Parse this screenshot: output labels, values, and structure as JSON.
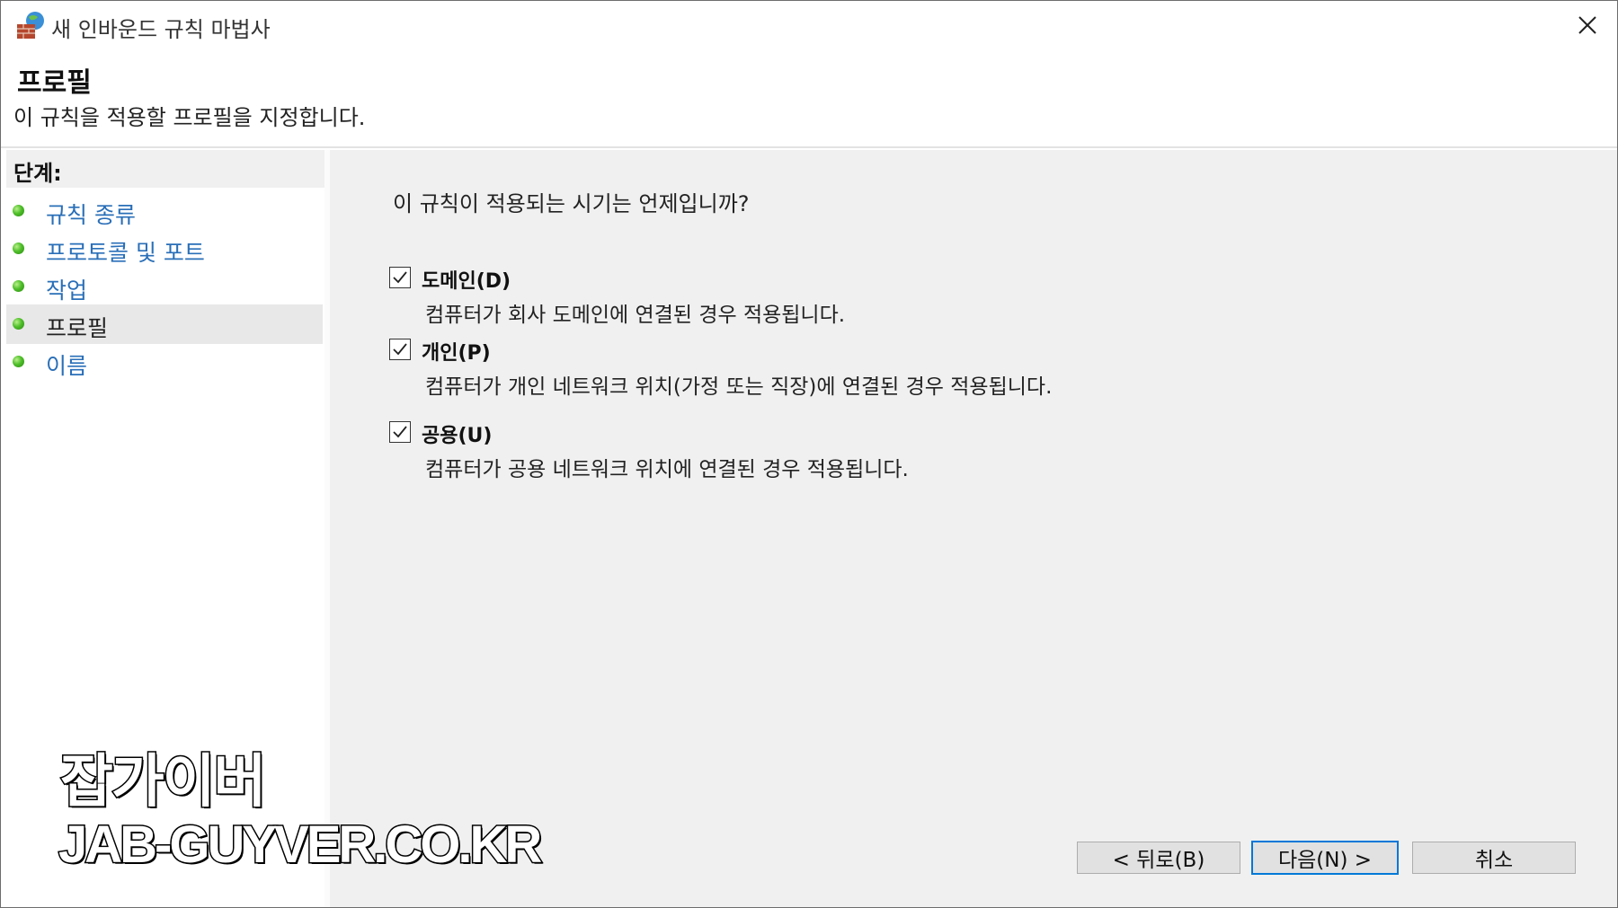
{
  "window": {
    "title": "새 인바운드 규칙 마법사",
    "close_icon": "close-icon"
  },
  "header": {
    "title": "프로필",
    "subtitle": "이 규칙을 적용할 프로필을 지정합니다."
  },
  "steps": {
    "heading": "단계:",
    "items": [
      {
        "label": "규칙 종류",
        "current": false
      },
      {
        "label": "프로토콜 및 포트",
        "current": false
      },
      {
        "label": "작업",
        "current": false
      },
      {
        "label": "프로필",
        "current": true
      },
      {
        "label": "이름",
        "current": false
      }
    ]
  },
  "main": {
    "question": "이 규칙이 적용되는 시기는 언제입니까?",
    "options": [
      {
        "title": "도메인(D)",
        "description": "컴퓨터가 회사 도메인에 연결된 경우 적용됩니다.",
        "checked": true
      },
      {
        "title": "개인(P)",
        "description": "컴퓨터가 개인 네트워크 위치(가정 또는 직장)에 연결된 경우 적용됩니다.",
        "checked": true
      },
      {
        "title": "공용(U)",
        "description": "컴퓨터가 공용 네트워크 위치에 연결된 경우 적용됩니다.",
        "checked": true
      }
    ]
  },
  "buttons": {
    "back": "< 뒤로(B)",
    "next": "다음(N) >",
    "cancel": "취소"
  },
  "watermark": {
    "name": "잡가이버",
    "url": "JAB-GUYVER.CO.KR"
  },
  "colors": {
    "accent": "#0078d7",
    "link": "#2a6fb8",
    "main_bg": "#f0f0f0",
    "step_dot": "#4fbf2a"
  }
}
